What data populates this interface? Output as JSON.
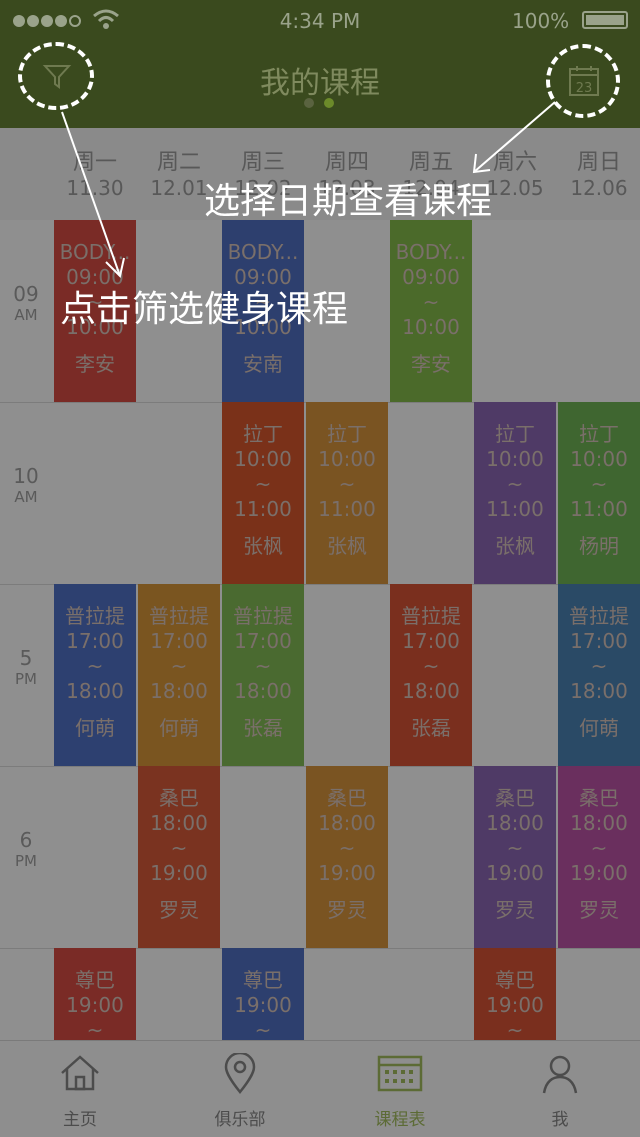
{
  "status": {
    "time": "4:34 PM",
    "battery": "100%"
  },
  "title": "我的课程",
  "days": [
    {
      "name": "周一",
      "date": "11.30"
    },
    {
      "name": "周二",
      "date": "12.01"
    },
    {
      "name": "周三",
      "date": "12.02"
    },
    {
      "name": "周四",
      "date": "12.03"
    },
    {
      "name": "周五",
      "date": "12.04"
    },
    {
      "name": "周六",
      "date": "12.05"
    },
    {
      "name": "周日",
      "date": "12.06"
    }
  ],
  "times": [
    {
      "h": "09",
      "ap": "AM"
    },
    {
      "h": "10",
      "ap": "AM"
    },
    {
      "h": "5",
      "ap": "PM"
    },
    {
      "h": "6",
      "ap": "PM"
    }
  ],
  "classes": [
    {
      "day": 0,
      "row": 0,
      "name": "BODY...",
      "start": "09:00",
      "sep": "~",
      "end": "10:00",
      "coach": "李安",
      "color": "#7a2b26"
    },
    {
      "day": 2,
      "row": 0,
      "name": "BODY...",
      "start": "09:00",
      "sep": "~",
      "end": "10:00",
      "coach": "安南",
      "color": "#2d3f6e"
    },
    {
      "day": 4,
      "row": 0,
      "name": "BODY...",
      "start": "09:00",
      "sep": "~",
      "end": "10:00",
      "coach": "李安",
      "color": "#4b6a2a"
    },
    {
      "day": 2,
      "row": 1,
      "name": "拉丁",
      "start": "10:00",
      "sep": "~",
      "end": "11:00",
      "coach": "张枫",
      "color": "#7a3119"
    },
    {
      "day": 3,
      "row": 1,
      "name": "拉丁",
      "start": "10:00",
      "sep": "~",
      "end": "11:00",
      "coach": "张枫",
      "color": "#7a5422"
    },
    {
      "day": 5,
      "row": 1,
      "name": "拉丁",
      "start": "10:00",
      "sep": "~",
      "end": "11:00",
      "coach": "张枫",
      "color": "#4f3a66"
    },
    {
      "day": 6,
      "row": 1,
      "name": "拉丁",
      "start": "10:00",
      "sep": "~",
      "end": "11:00",
      "coach": "杨明",
      "color": "#3f6630"
    },
    {
      "day": 0,
      "row": 2,
      "name": "普拉提",
      "start": "17:00",
      "sep": "~",
      "end": "18:00",
      "coach": "何萌",
      "color": "#2d4070"
    },
    {
      "day": 1,
      "row": 2,
      "name": "普拉提",
      "start": "17:00",
      "sep": "~",
      "end": "18:00",
      "coach": "何萌",
      "color": "#7a5520"
    },
    {
      "day": 2,
      "row": 2,
      "name": "普拉提",
      "start": "17:00",
      "sep": "~",
      "end": "18:00",
      "coach": "张磊",
      "color": "#4a6a30"
    },
    {
      "day": 4,
      "row": 2,
      "name": "普拉提",
      "start": "17:00",
      "sep": "~",
      "end": "18:00",
      "coach": "张磊",
      "color": "#7a2f1e"
    },
    {
      "day": 6,
      "row": 2,
      "name": "普拉提",
      "start": "17:00",
      "sep": "~",
      "end": "18:00",
      "coach": "何萌",
      "color": "#2a4a66"
    },
    {
      "day": 1,
      "row": 3,
      "name": "桑巴",
      "start": "18:00",
      "sep": "~",
      "end": "19:00",
      "coach": "罗灵",
      "color": "#7a3320"
    },
    {
      "day": 3,
      "row": 3,
      "name": "桑巴",
      "start": "18:00",
      "sep": "~",
      "end": "19:00",
      "coach": "罗灵",
      "color": "#7a5422"
    },
    {
      "day": 5,
      "row": 3,
      "name": "桑巴",
      "start": "18:00",
      "sep": "~",
      "end": "19:00",
      "coach": "罗灵",
      "color": "#4f3a66"
    },
    {
      "day": 6,
      "row": 3,
      "name": "桑巴",
      "start": "18:00",
      "sep": "~",
      "end": "19:00",
      "coach": "罗灵",
      "color": "#6a2f5e"
    },
    {
      "day": 0,
      "row": 4,
      "name": "尊巴",
      "start": "19:00",
      "sep": "~",
      "end": "",
      "coach": "",
      "color": "#7a2b26"
    },
    {
      "day": 2,
      "row": 4,
      "name": "尊巴",
      "start": "19:00",
      "sep": "~",
      "end": "",
      "coach": "",
      "color": "#2d3f6e"
    },
    {
      "day": 5,
      "row": 4,
      "name": "尊巴",
      "start": "19:00",
      "sep": "~",
      "end": "",
      "coach": "",
      "color": "#7a2f1e"
    }
  ],
  "tabs": [
    {
      "label": "主页",
      "icon": "home-icon",
      "active": false
    },
    {
      "label": "俱乐部",
      "icon": "location-pin-icon",
      "active": false
    },
    {
      "label": "课程表",
      "icon": "calendar-grid-icon",
      "active": true
    },
    {
      "label": "我",
      "icon": "person-icon",
      "active": false
    }
  ],
  "annotations": {
    "date_hint": "选择日期查看课程",
    "filter_hint": "点击筛选健身课程"
  },
  "calendar_icon_day": "23",
  "colors": {
    "header": "#3a4a1e",
    "active_tab": "#5c6b35",
    "overlay": "#8f8f8f"
  }
}
